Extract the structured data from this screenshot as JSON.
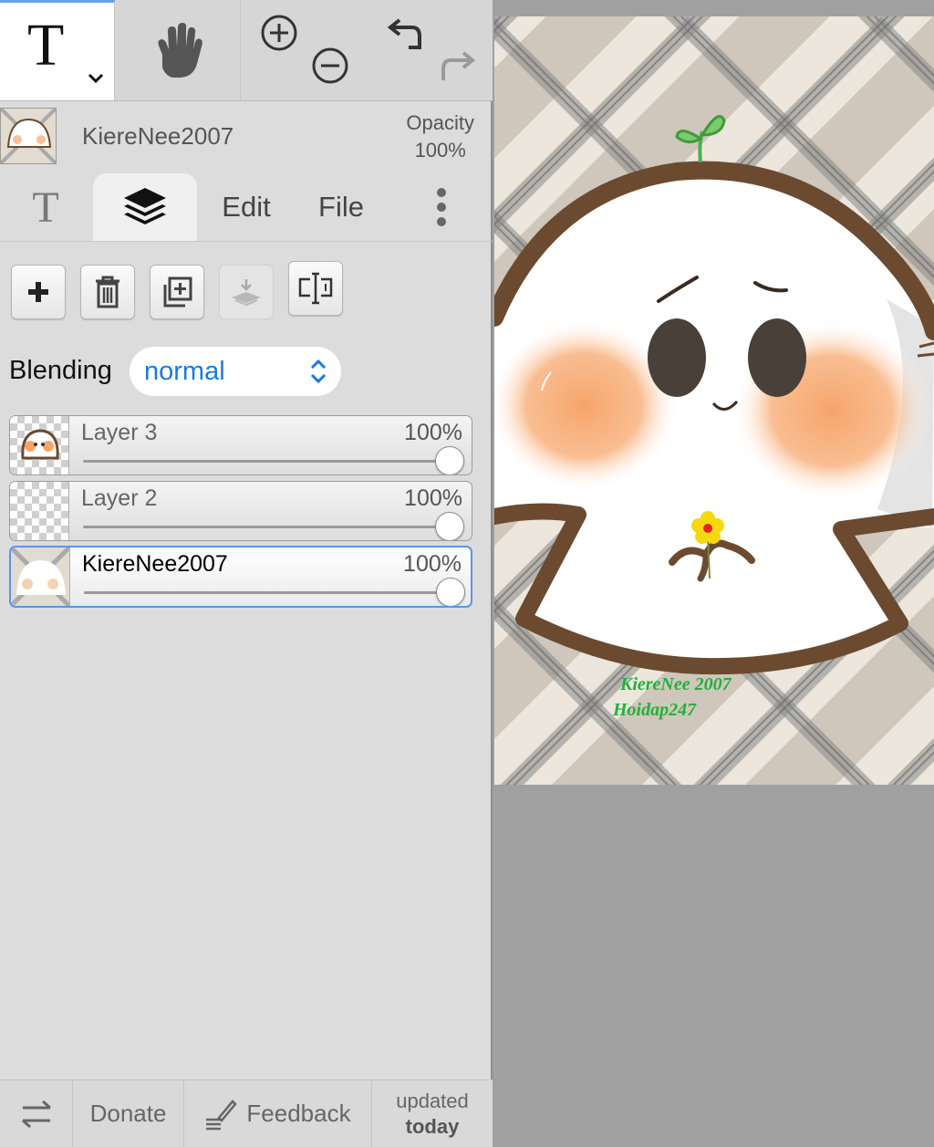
{
  "toolbar": {
    "tools": [
      {
        "name": "text-tool",
        "icon": "text-T-icon"
      },
      {
        "name": "pan-tool",
        "icon": "hand-icon"
      },
      {
        "name": "zoom",
        "icons": [
          "zoom-in-icon",
          "zoom-out-icon"
        ]
      },
      {
        "name": "history",
        "icons": [
          "undo-icon",
          "redo-icon"
        ]
      }
    ],
    "text_glyph": "T",
    "accent": "#6aa0e8"
  },
  "header": {
    "document_name": "KiereNee2007",
    "opacity_label": "Opacity",
    "opacity_value": "100%"
  },
  "tabs": {
    "text_tab": "T",
    "edit": "Edit",
    "file": "File",
    "selected": "layers"
  },
  "layer_actions": [
    "add-layer",
    "delete-layer",
    "duplicate-layer",
    "merge-down (disabled)",
    "rename-layer"
  ],
  "blending": {
    "label": "Blending",
    "value": "normal",
    "value_color": "#1a7ae0"
  },
  "layers": [
    {
      "name": "Layer 3",
      "opacity": "100%",
      "opacity_fraction": 1.0,
      "selected": false
    },
    {
      "name": "Layer 2",
      "opacity": "100%",
      "opacity_fraction": 1.0,
      "selected": false
    },
    {
      "name": "KiereNee2007",
      "opacity": "100%",
      "opacity_fraction": 1.0,
      "selected": true
    }
  ],
  "bottom_bar": {
    "donate": "Donate",
    "feedback": "Feedback",
    "updated_line1": "updated",
    "updated_line2": "today"
  },
  "artwork": {
    "signature_line1": "KiereNee 2007",
    "signature_line2": "Hoidap247",
    "colors": {
      "outline": "#6b4a30",
      "blush": "#f6a46a",
      "leaf": "#4caf50",
      "flower": "#f5d80f",
      "signature": "#22b03a",
      "background": "#ece6dc"
    }
  }
}
